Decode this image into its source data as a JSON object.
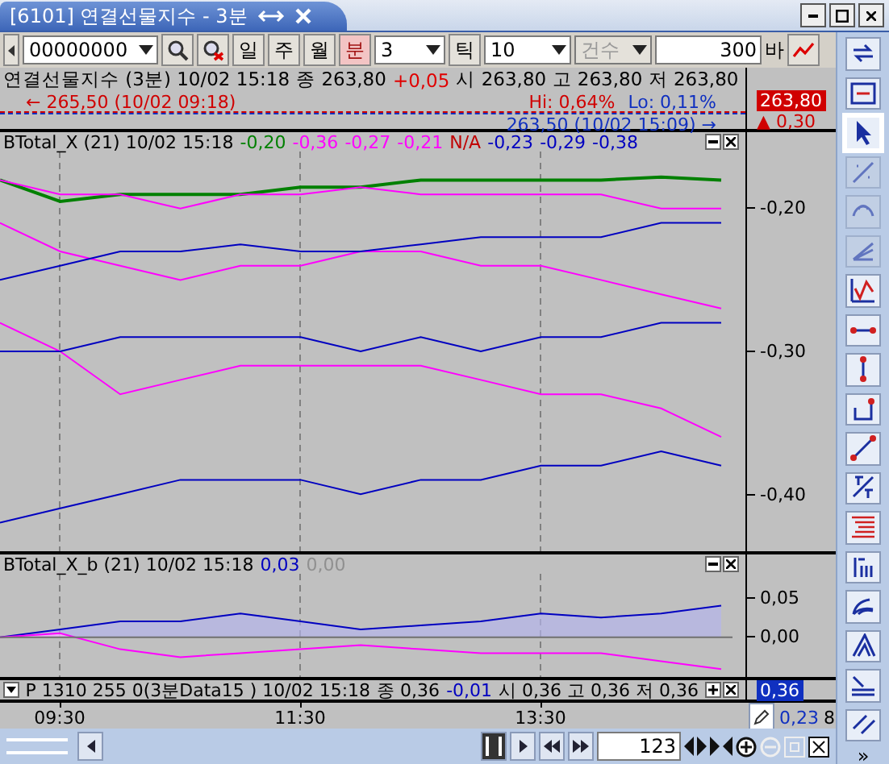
{
  "window": {
    "title": "[6101] 연결선물지수  - 3분"
  },
  "toolbar": {
    "code": "00000000",
    "periods": [
      {
        "label": "일",
        "selected": false
      },
      {
        "label": "주",
        "selected": false
      },
      {
        "label": "월",
        "selected": false
      },
      {
        "label": "분",
        "selected": true
      }
    ],
    "interval": "3",
    "tick_button": "틱",
    "tick_count": "10",
    "count_mode": {
      "value": "건수",
      "disabled": true
    },
    "bars": "300",
    "bars_unit": "바"
  },
  "price_pane": {
    "legend": [
      {
        "text": "연결선물지수 (3분) 10/02 15:18",
        "color": "#000000"
      },
      {
        "text": "종 263,80",
        "color": "#000000"
      },
      {
        "text": "+0,05",
        "color": "#e00000"
      },
      {
        "text": "시 263,80 고 263,80 저 263,80",
        "color": "#000000"
      }
    ],
    "high_marker": "← 265,50 (10/02 09:18)",
    "low_marker": "263,50 (10/02 15:09) →",
    "hi": "Hi: 0,64%",
    "lo": "Lo: 0,11%",
    "last_price": "263,80",
    "change": "▲ 0,30"
  },
  "panes": [
    {
      "title": "BTotal_X  (21) 10/02 15:18",
      "legend": [
        {
          "text": "-0,20",
          "color": "#008000"
        },
        {
          "text": "-0,36",
          "color": "#ff00ff"
        },
        {
          "text": "-0,27",
          "color": "#ff00ff"
        },
        {
          "text": "-0,21",
          "color": "#ff00ff"
        },
        {
          "text": "N/A",
          "color": "#c00000"
        },
        {
          "text": "-0,23",
          "color": "#0000c0"
        },
        {
          "text": "-0,29",
          "color": "#0000c0"
        },
        {
          "text": "-0,38",
          "color": "#0000c0"
        }
      ],
      "chart_data": {
        "type": "line",
        "grid": true,
        "ylim": [
          -0.44,
          -0.16
        ],
        "yticks": [
          {
            "value": -0.2,
            "label": "-0,20"
          },
          {
            "value": -0.3,
            "label": "-0,30"
          },
          {
            "value": -0.4,
            "label": "-0,40"
          }
        ],
        "series": [
          {
            "color": "#008000",
            "values": [
              -0.18,
              -0.195,
              -0.19,
              -0.19,
              -0.19,
              -0.185,
              -0.185,
              -0.18,
              -0.18,
              -0.18,
              -0.18,
              -0.178,
              -0.18
            ]
          },
          {
            "color": "#ff00ff",
            "values": [
              -0.28,
              -0.3,
              -0.33,
              -0.32,
              -0.31,
              -0.31,
              -0.31,
              -0.31,
              -0.32,
              -0.33,
              -0.33,
              -0.34,
              -0.36
            ]
          },
          {
            "color": "#ff00ff",
            "values": [
              -0.21,
              -0.23,
              -0.24,
              -0.25,
              -0.24,
              -0.24,
              -0.23,
              -0.23,
              -0.24,
              -0.24,
              -0.25,
              -0.26,
              -0.27
            ]
          },
          {
            "color": "#ff00ff",
            "values": [
              -0.18,
              -0.19,
              -0.19,
              -0.2,
              -0.19,
              -0.19,
              -0.185,
              -0.19,
              -0.19,
              -0.19,
              -0.19,
              -0.2,
              -0.2
            ]
          },
          {
            "color": "#0000c0",
            "values": [
              -0.25,
              -0.24,
              -0.23,
              -0.23,
              -0.225,
              -0.23,
              -0.23,
              -0.225,
              -0.22,
              -0.22,
              -0.22,
              -0.21,
              -0.21
            ]
          },
          {
            "color": "#0000c0",
            "values": [
              -0.3,
              -0.3,
              -0.29,
              -0.29,
              -0.29,
              -0.29,
              -0.3,
              -0.29,
              -0.3,
              -0.29,
              -0.29,
              -0.28,
              -0.28
            ]
          },
          {
            "color": "#0000c0",
            "values": [
              -0.42,
              -0.41,
              -0.4,
              -0.39,
              -0.39,
              -0.39,
              -0.4,
              -0.39,
              -0.39,
              -0.38,
              -0.38,
              -0.37,
              -0.38
            ]
          }
        ]
      }
    },
    {
      "title": "BTotal_X_b  (21) 10/02 15:18",
      "legend": [
        {
          "text": "0,03",
          "color": "#0000c0"
        },
        {
          "text": "0,00",
          "color": "#909090"
        }
      ],
      "chart_data": {
        "type": "area",
        "grid": true,
        "ylim": [
          -0.05,
          0.08
        ],
        "yticks": [
          {
            "value": 0.05,
            "label": "0,05"
          },
          {
            "value": 0,
            "label": "0,00"
          }
        ],
        "series": [
          {
            "color": "#0000c0",
            "values": [
              0,
              0.01,
              0.02,
              0.02,
              0.03,
              0.02,
              0.01,
              0.015,
              0.02,
              0.03,
              0.025,
              0.03,
              0.04
            ]
          },
          {
            "color": "#ff00ff",
            "values": [
              0,
              0.005,
              -0.015,
              -0.025,
              -0.02,
              -0.015,
              -0.01,
              -0.015,
              -0.02,
              -0.02,
              -0.02,
              -0.03,
              -0.04
            ]
          }
        ]
      }
    }
  ],
  "indicator_pane": {
    "collapsed": true,
    "title": "P 1310 255 0(3분Data15 ) 10/02 15:18",
    "legend": [
      {
        "text": "종 0,36",
        "color": "#000000"
      },
      {
        "text": "-0,01",
        "color": "#0000c0"
      },
      {
        "text": "시 0,36 고 0,36 저 0,36",
        "color": "#000000"
      }
    ],
    "high": "0,36",
    "low": "0,23",
    "count": "8"
  },
  "time_axis": [
    "09:30",
    "11:30",
    "13:30"
  ],
  "bottom_bar": {
    "bar_count": "123"
  },
  "tools": [
    {
      "kind": "sync",
      "selected": false,
      "disabled": false
    },
    {
      "kind": "fit",
      "selected": false,
      "disabled": false
    },
    {
      "kind": "pointer",
      "selected": true,
      "disabled": false
    },
    {
      "kind": "ratio",
      "selected": false,
      "disabled": true
    },
    {
      "kind": "cycle",
      "selected": false,
      "disabled": true
    },
    {
      "kind": "fan",
      "selected": false,
      "disabled": true
    },
    {
      "kind": "wave",
      "selected": false,
      "disabled": false
    },
    {
      "kind": "hline",
      "selected": false,
      "disabled": false
    },
    {
      "kind": "vline",
      "selected": false,
      "disabled": false
    },
    {
      "kind": "step",
      "selected": false,
      "disabled": false
    },
    {
      "kind": "trend",
      "selected": false,
      "disabled": false
    },
    {
      "kind": "text",
      "selected": false,
      "disabled": false
    },
    {
      "kind": "levels",
      "selected": false,
      "disabled": false
    },
    {
      "kind": "fibo",
      "selected": false,
      "disabled": false
    },
    {
      "kind": "arcs",
      "selected": false,
      "disabled": false
    },
    {
      "kind": "fanlines",
      "selected": false,
      "disabled": false
    },
    {
      "kind": "retrace",
      "selected": false,
      "disabled": false
    },
    {
      "kind": "channel",
      "selected": false,
      "disabled": false
    }
  ],
  "tools_more": "»"
}
